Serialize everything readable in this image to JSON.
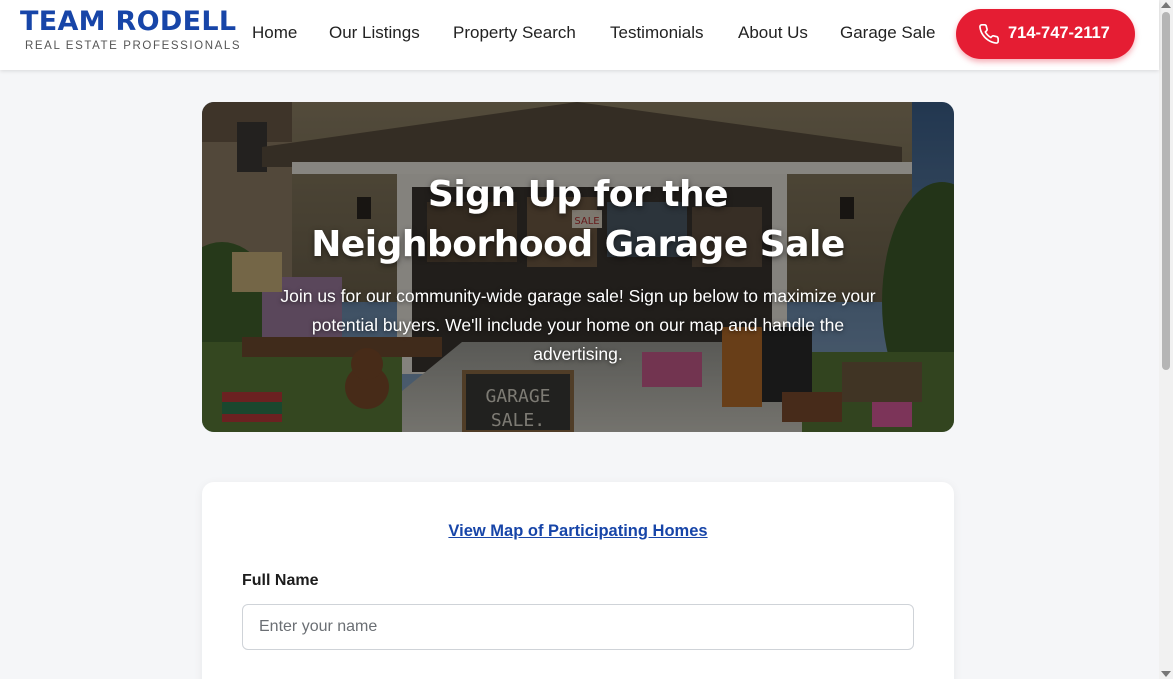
{
  "brand": {
    "name": "TEAM RODELL",
    "tagline": "REAL ESTATE PROFESSIONALS",
    "primary_color": "#1745a8"
  },
  "nav": {
    "items": [
      {
        "label": "Home"
      },
      {
        "label": "Our Listings"
      },
      {
        "label": "Property Search"
      },
      {
        "label": "Testimonials"
      },
      {
        "label": "About Us"
      },
      {
        "label": "Garage Sale"
      }
    ],
    "phone": {
      "label": "714-747-2117",
      "icon": "phone-icon",
      "color": "#e51d33"
    }
  },
  "hero": {
    "title_line1": "Sign Up for the",
    "title_line2": "Neighborhood Garage Sale",
    "description": "Join us for our community-wide garage sale! Sign up below to maximize your potential buyers. We'll include your home on our map and handle the advertising.",
    "sign_text_line1": "GARAGE",
    "sign_text_line2": "SALE.",
    "sale_tag": "SALE"
  },
  "form": {
    "map_link": "View Map of Participating Homes",
    "full_name": {
      "label": "Full Name",
      "placeholder": "Enter your name",
      "value": ""
    }
  }
}
